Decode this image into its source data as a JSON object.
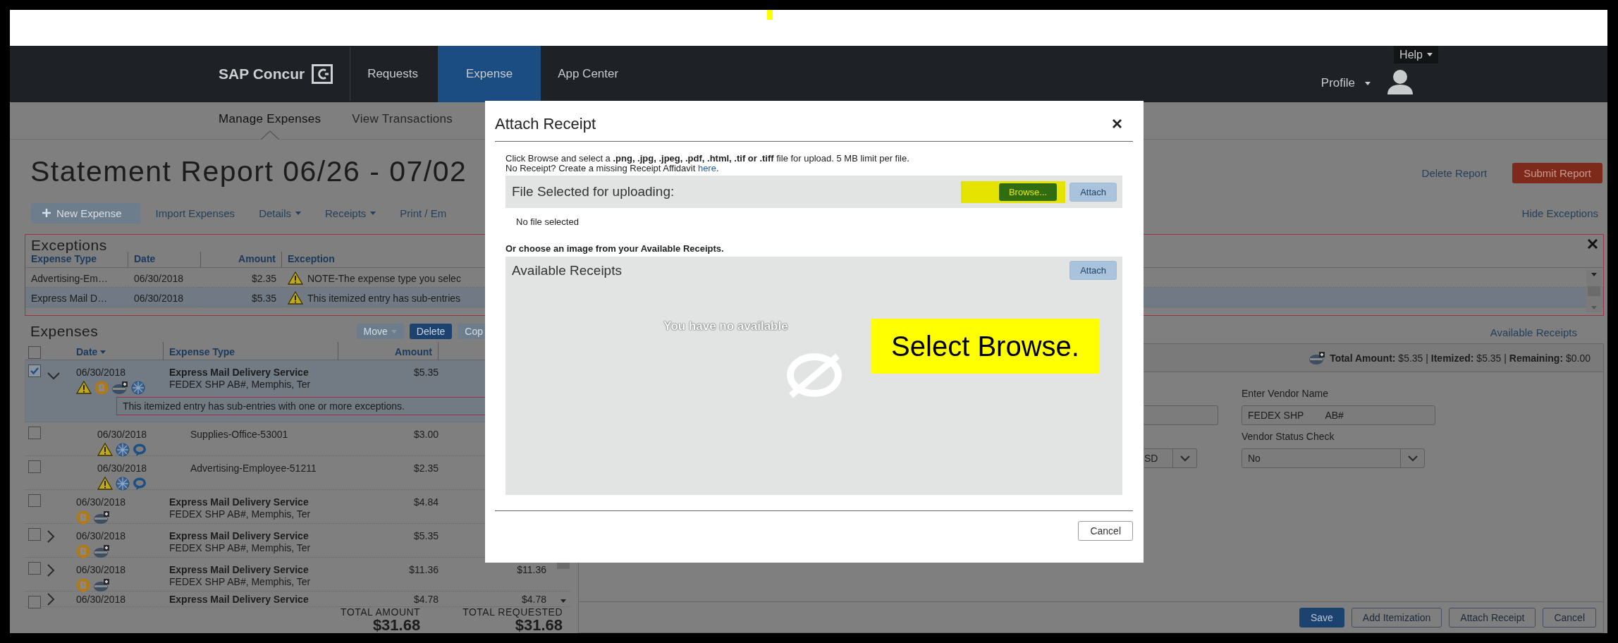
{
  "nav": {
    "logo": "SAP Concur",
    "tabs": [
      {
        "label": "Requests",
        "selected": false
      },
      {
        "label": "Expense",
        "selected": true
      },
      {
        "label": "App Center",
        "selected": false
      }
    ],
    "help": "Help",
    "profile": "Profile"
  },
  "subnav": [
    {
      "label": "Manage Expenses",
      "selected": true
    },
    {
      "label": "View Transactions",
      "selected": false
    }
  ],
  "report": {
    "title": "Statement Report 06/26 - 07/02",
    "delete_link": "Delete Report",
    "submit_button": "Submit Report"
  },
  "toolbar": {
    "new_expense": {
      "label": "New Expense",
      "disabled": true
    },
    "items": [
      {
        "label": "Import Expenses",
        "kind": "link"
      },
      {
        "label": "Details",
        "kind": "menu"
      },
      {
        "label": "Receipts",
        "kind": "menu"
      },
      {
        "label": "Print / Em",
        "kind": "link"
      }
    ],
    "hide_exceptions": "Hide Exceptions"
  },
  "exceptions": {
    "title": "Exceptions",
    "columns": [
      "Expense Type",
      "Date",
      "Amount",
      "Exception"
    ],
    "rows": [
      {
        "expense_type": "Advertising-Em…",
        "date": "06/30/2018",
        "amount": "$2.35",
        "exception": "NOTE-The expense type you selec",
        "selected": false
      },
      {
        "expense_type": "Express Mail D…",
        "date": "06/30/2018",
        "amount": "$5.35",
        "exception": "This itemized entry has sub-entries",
        "selected": true
      }
    ]
  },
  "expenses": {
    "title": "Expenses",
    "actions": [
      {
        "label": "Move",
        "kind": "menu",
        "disabled": true
      },
      {
        "label": "Delete",
        "kind": "button",
        "disabled": false
      },
      {
        "label": "Cop",
        "kind": "button",
        "disabled": true
      }
    ],
    "select_all": {
      "checked": false
    },
    "columns": [
      "Date",
      "Expense Type",
      "Amount"
    ],
    "rows": [
      {
        "kind": "expense",
        "checked": true,
        "selected": true,
        "expandable": true,
        "expanded": true,
        "date": "06/30/2018",
        "type": "Express Mail Delivery Service",
        "vendor": "FEDEX SHP AB#, Memphis, Ter",
        "amount": "$5.35",
        "icons": [
          {
            "kind": "warning"
          },
          {
            "kind": "receipt"
          },
          {
            "kind": "card"
          },
          {
            "kind": "globe"
          }
        ],
        "note": "This itemized entry has sub-entries with one or more exceptions."
      },
      {
        "kind": "itemization",
        "checked": false,
        "selected": false,
        "expandable": false,
        "date": "06/30/2018",
        "type": "Supplies-Office-53001",
        "amount": "$3.00",
        "icons": [
          {
            "kind": "warning"
          },
          {
            "kind": "globe"
          },
          {
            "kind": "chat"
          }
        ]
      },
      {
        "kind": "itemization",
        "checked": false,
        "selected": false,
        "expandable": false,
        "date": "06/30/2018",
        "type": "Advertising-Employee-51211",
        "amount": "$2.35",
        "icons": [
          {
            "kind": "warning"
          },
          {
            "kind": "globe"
          },
          {
            "kind": "chat"
          }
        ]
      },
      {
        "kind": "expense",
        "checked": false,
        "selected": false,
        "expandable": false,
        "date": "06/30/2018",
        "type": "Express Mail Delivery Service",
        "vendor": "FEDEX SHP AB#, Memphis, Ter",
        "amount": "$4.84",
        "icons": [
          {
            "kind": "receipt"
          },
          {
            "kind": "card"
          }
        ]
      },
      {
        "kind": "expense",
        "checked": false,
        "selected": false,
        "expandable": true,
        "expanded": false,
        "date": "06/30/2018",
        "type": "Express Mail Delivery Service",
        "vendor": "FEDEX SHP AB#, Memphis, Ter",
        "amount": "$5.35",
        "icons": [
          {
            "kind": "receipt"
          },
          {
            "kind": "card"
          }
        ]
      },
      {
        "kind": "expense",
        "checked": false,
        "selected": false,
        "expandable": true,
        "expanded": false,
        "date": "06/30/2018",
        "type": "Express Mail Delivery Service",
        "vendor": "FEDEX SHP AB#, Memphis, Ter",
        "amount": "$11.36",
        "requested": "$11.36",
        "icons": [
          {
            "kind": "receipt"
          },
          {
            "kind": "card"
          }
        ]
      },
      {
        "kind": "expense",
        "checked": false,
        "selected": false,
        "expandable": true,
        "expanded": false,
        "date": "06/30/2018",
        "type": "Express Mail Delivery Service",
        "amount": "$4.78",
        "requested": "$4.78",
        "icons": []
      }
    ],
    "totals": [
      {
        "label": "TOTAL AMOUNT",
        "value": "$31.68"
      },
      {
        "label": "TOTAL REQUESTED",
        "value": "$31.68"
      }
    ]
  },
  "detail": {
    "available_receipts_link": "Available Receipts",
    "summary": "**Total Amount:** $5.35 | **Itemized:** $5.35 | **Remaining:** $0.00",
    "currency": "SD",
    "vendor_name": {
      "label": "Enter Vendor Name",
      "value": "FEDEX SHP        AB#"
    },
    "vendor_status": {
      "label": "Vendor Status Check",
      "value": "No"
    },
    "buttons": [
      {
        "label": "Save",
        "kind": "primary"
      },
      {
        "label": "Add Itemization",
        "kind": "secondary"
      },
      {
        "label": "Attach Receipt",
        "kind": "secondary"
      },
      {
        "label": "Cancel",
        "kind": "secondary"
      }
    ]
  },
  "dialog": {
    "title": "Attach Receipt",
    "instructions": "Click Browse and select a **.png, .jpg, .jpeg, .pdf, .html, .tif or .tiff** file for upload. 5 MB limit per file.",
    "affidavit": {
      "before": "No Receipt? Create a missing Receipt Affidavit ",
      "link": "here",
      "after": "."
    },
    "file_section": {
      "title": "File Selected for uploading:",
      "browse": {
        "label": "Browse...",
        "highlighted": true
      },
      "attach": {
        "label": "Attach",
        "disabled": true
      },
      "status": "No file selected"
    },
    "choose_text": "Or choose an image from your Available Receipts.",
    "receipts": {
      "title": "Available Receipts",
      "attach": {
        "label": "Attach",
        "disabled": true
      },
      "empty_message": "You have no available"
    },
    "cancel": "Cancel",
    "callout": "Select Browse."
  }
}
